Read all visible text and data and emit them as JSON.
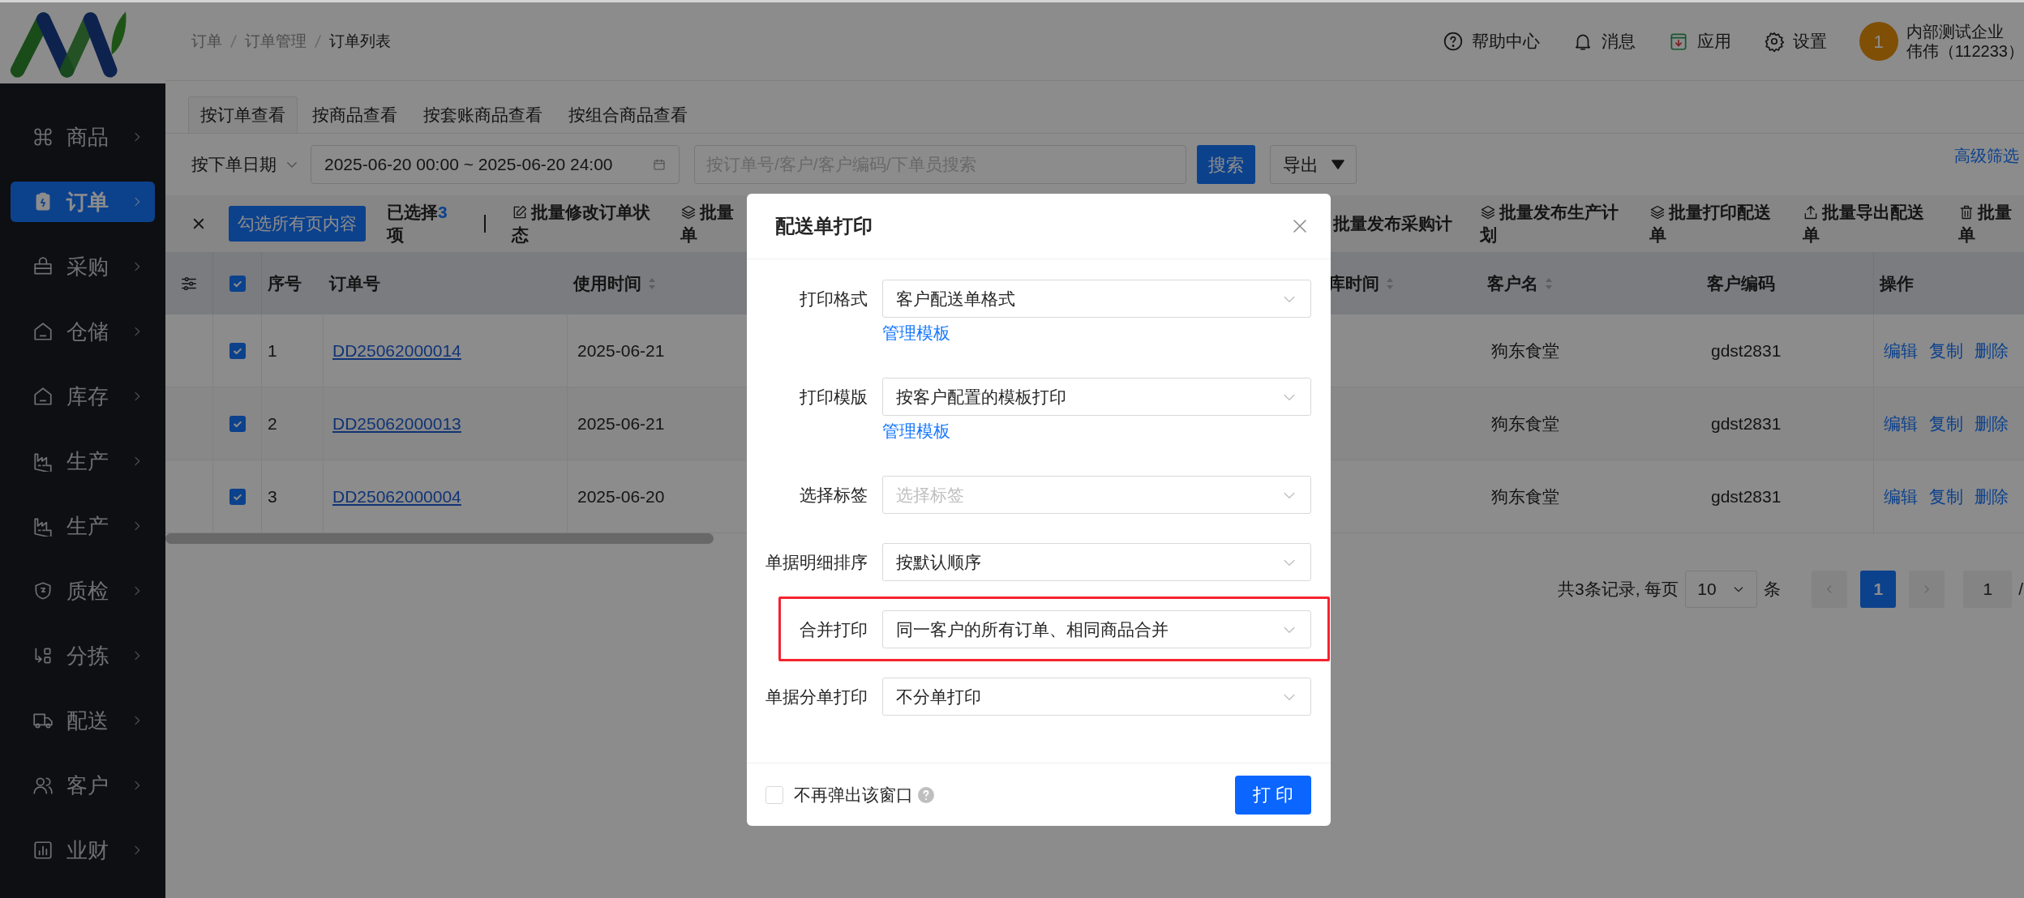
{
  "breadcrumb": [
    "订单",
    "订单管理",
    "订单列表"
  ],
  "header_actions": [
    {
      "label": "帮助中心",
      "kind": "help"
    },
    {
      "label": "消息",
      "kind": "bell"
    },
    {
      "label": "应用",
      "kind": "app"
    },
    {
      "label": "设置",
      "kind": "gear"
    }
  ],
  "user": {
    "avatar": "1",
    "company": "内部测试企业",
    "name": "伟伟（112233）"
  },
  "sidebar": {
    "items": [
      {
        "label": "商品",
        "kind": "command",
        "selected": false
      },
      {
        "label": "订单",
        "kind": "clipboard",
        "selected": true
      },
      {
        "label": "采购",
        "kind": "basket",
        "selected": false
      },
      {
        "label": "仓储",
        "kind": "warehouse",
        "selected": false
      },
      {
        "label": "库存",
        "kind": "warehouse",
        "selected": false
      },
      {
        "label": "生产",
        "kind": "factory",
        "selected": false
      },
      {
        "label": "生产",
        "kind": "factory",
        "selected": false
      },
      {
        "label": "质检",
        "kind": "shield",
        "selected": false
      },
      {
        "label": "分拣",
        "kind": "sort",
        "selected": false
      },
      {
        "label": "配送",
        "kind": "truck",
        "selected": false
      },
      {
        "label": "客户",
        "kind": "users",
        "selected": false
      },
      {
        "label": "业财",
        "kind": "chart",
        "selected": false
      }
    ]
  },
  "view_tabs": [
    {
      "label": "按订单查看",
      "selected": true
    },
    {
      "label": "按商品查看",
      "selected": false
    },
    {
      "label": "按套账商品查看",
      "selected": false
    },
    {
      "label": "按组合商品查看",
      "selected": false
    }
  ],
  "filters": {
    "date_type": "按下单日期",
    "date_range": "2025-06-20 00:00 ~ 2025-06-20 24:00",
    "search": {
      "placeholder": "按订单号/客户/客户编码/下单员搜索"
    },
    "search_button": "搜索",
    "export_button": "导出",
    "advanced_link": "高级筛选"
  },
  "batch_bar": {
    "select_all_button": "勾选所有页内容",
    "selected_label": "已选择",
    "selected_count": "3",
    "selected_unit": "项",
    "actions": [
      {
        "label": "批量修改订单状态"
      },
      {
        "label": "批量单"
      },
      {
        "label": "批量发布采购计"
      },
      {
        "label": "批量发布生产计划"
      },
      {
        "label": "批量打印配送单"
      },
      {
        "label": "批量导出配送单"
      },
      {
        "label": "批量单"
      }
    ]
  },
  "table": {
    "header_checked": true,
    "columns": [
      {
        "label": "序号",
        "sortable": false
      },
      {
        "label": "订单号",
        "sortable": false
      },
      {
        "label": "使用时间",
        "sortable": true
      },
      {
        "label": "库时间",
        "sortable": true
      },
      {
        "label": "客户名",
        "sortable": true
      },
      {
        "label": "客户编码",
        "sortable": false
      },
      {
        "label": "操作",
        "sortable": false
      }
    ],
    "rows": [
      {
        "checked": true,
        "index": "1",
        "order_no": "DD25062000014",
        "use_time": "2025-06-21",
        "customer": "狗东食堂",
        "customer_code": "gdst2831",
        "actions": [
          "编辑",
          "复制",
          "删除"
        ]
      },
      {
        "checked": true,
        "index": "2",
        "order_no": "DD25062000013",
        "use_time": "2025-06-21",
        "customer": "狗东食堂",
        "customer_code": "gdst2831",
        "actions": [
          "编辑",
          "复制",
          "删除"
        ]
      },
      {
        "checked": true,
        "index": "3",
        "order_no": "DD25062000004",
        "use_time": "2025-06-20",
        "customer": "狗东食堂",
        "customer_code": "gdst2831",
        "actions": [
          "编辑",
          "复制",
          "删除"
        ]
      }
    ]
  },
  "pagination": {
    "summary": "共3条记录, 每页",
    "page_size": "10",
    "unit": "条",
    "pages": [
      {
        "label": "1",
        "selected": true
      }
    ],
    "jump_value": "1",
    "total_fragment": "/"
  },
  "modal": {
    "title": "配送单打印",
    "fields": [
      {
        "label": "打印格式",
        "value": "客户配送单格式",
        "link": "管理模板",
        "highlighted": false
      },
      {
        "label": "打印模版",
        "value": "按客户配置的模板打印",
        "link": "管理模板",
        "highlighted": false
      },
      {
        "label": "选择标签",
        "placeholder": "选择标签",
        "highlighted": false
      },
      {
        "label": "单据明细排序",
        "value": "按默认顺序",
        "highlighted": false
      },
      {
        "label": "合并打印",
        "value": "同一客户的所有订单、相同商品合并",
        "highlighted": true
      },
      {
        "label": "单据分单打印",
        "value": "不分单打印",
        "highlighted": false
      }
    ],
    "dont_show_again": {
      "label": "不再弹出该窗口",
      "checked": false
    },
    "print_button": "打 印"
  }
}
